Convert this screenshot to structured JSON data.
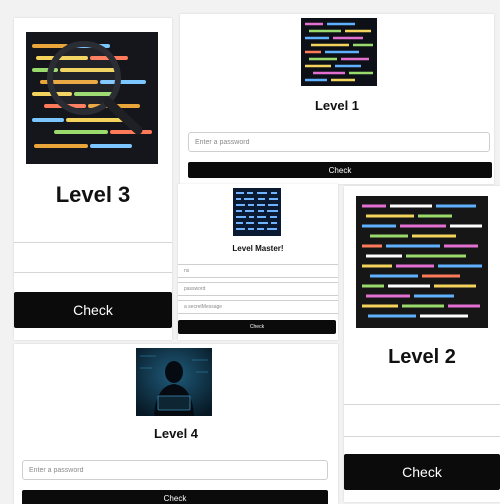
{
  "level3": {
    "title": "Level 3",
    "button": "Check"
  },
  "level1": {
    "title": "Level 1",
    "password_placeholder": "Enter a password",
    "button": "Check"
  },
  "master": {
    "title": "Level Master!",
    "field1_placeholder": "ns",
    "field2_placeholder": "password",
    "field3_placeholder": "a secretMessage",
    "button": "Check"
  },
  "level2": {
    "title": "Level 2",
    "button": "Check"
  },
  "level4": {
    "title": "Level 4",
    "password_placeholder": "Enter a password",
    "button": "Check"
  }
}
